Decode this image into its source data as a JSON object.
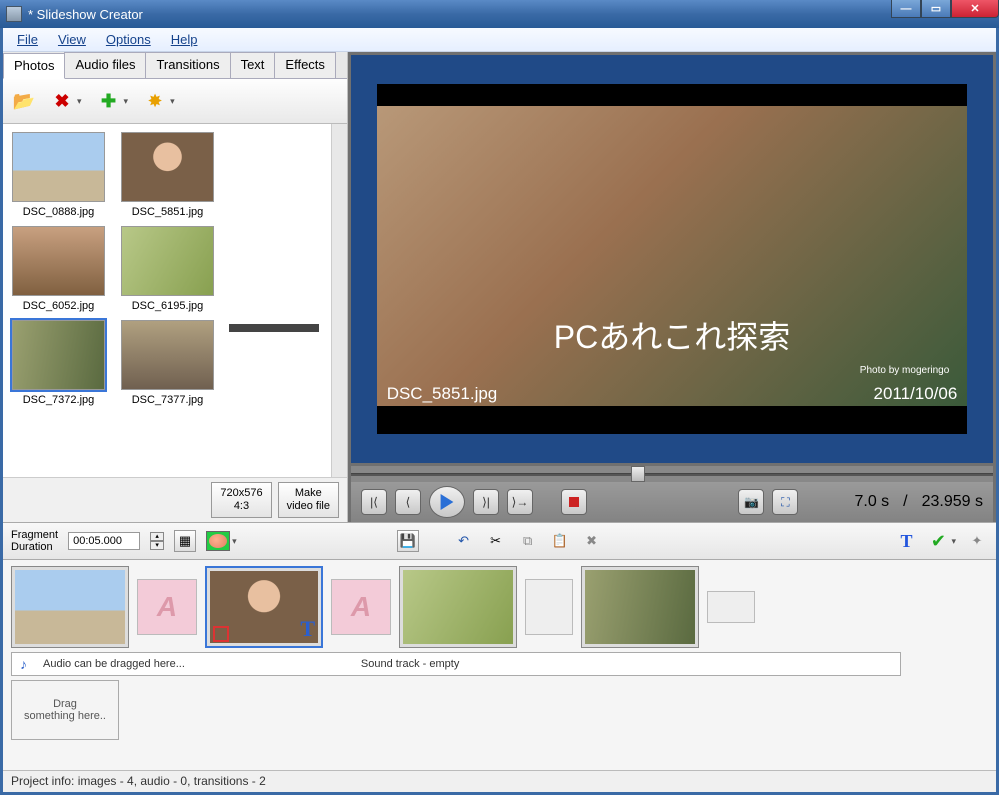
{
  "titlebar": {
    "title": " *  Slideshow Creator"
  },
  "menu": {
    "file": "File",
    "view": "View",
    "options": "Options",
    "help": "Help"
  },
  "tabs": {
    "photos": "Photos",
    "audio": "Audio files",
    "transitions": "Transitions",
    "text": "Text",
    "effects": "Effects"
  },
  "thumbs": [
    {
      "label": "DSC_0888.jpg"
    },
    {
      "label": "DSC_5851.jpg"
    },
    {
      "label": "DSC_6052.jpg"
    },
    {
      "label": "DSC_6195.jpg"
    },
    {
      "label": "DSC_7372.jpg"
    },
    {
      "label": "DSC_7377.jpg"
    }
  ],
  "leftbuttons": {
    "res": "720x576\n4:3",
    "make": "Make\nvideo file"
  },
  "preview": {
    "overlay": "PCあれこれ探索",
    "credit": "Photo by mogeringo",
    "filename": "DSC_5851.jpg",
    "date": "2011/10/06"
  },
  "time": {
    "current": "7.0 s",
    "sep": "/",
    "total": "23.959 s"
  },
  "frag": {
    "label1": "Fragment",
    "label2": "Duration",
    "value": "00:05.000"
  },
  "audio": {
    "drag": "Audio can be dragged here...",
    "empty": "Sound track - empty"
  },
  "dragbox": "Drag\nsomething here..",
  "status": "Project info: images - 4, audio - 0, transitions - 2"
}
